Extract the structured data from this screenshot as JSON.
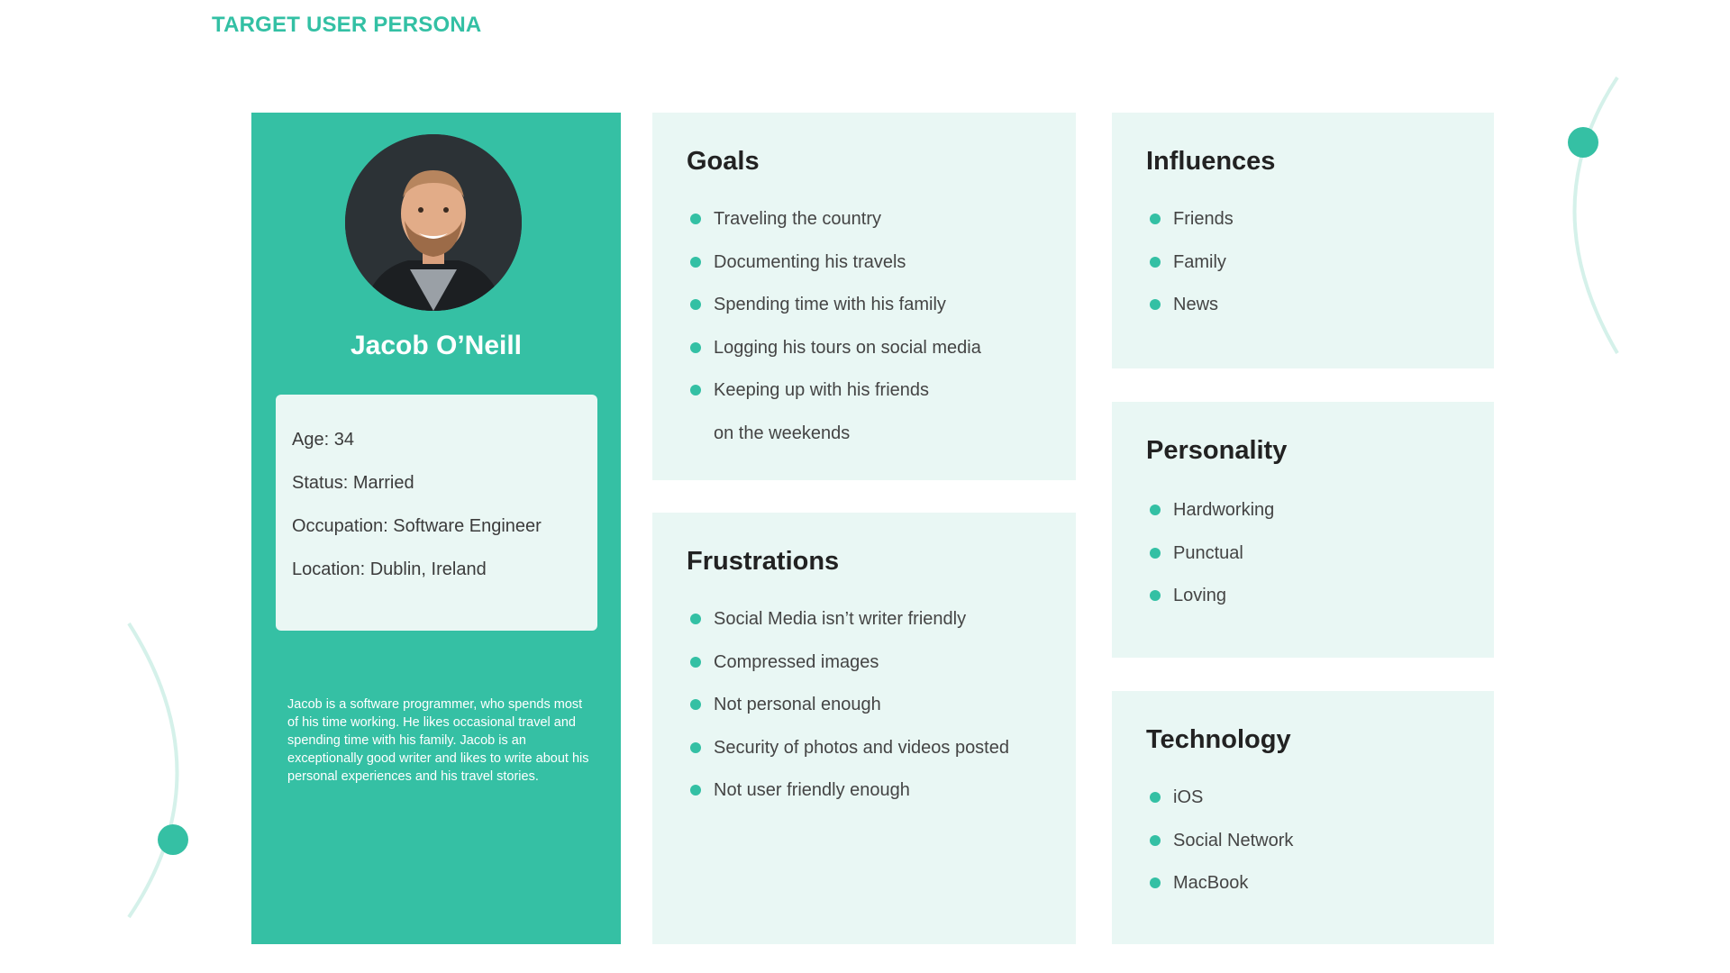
{
  "page": {
    "title": "TARGET USER PERSONA"
  },
  "colors": {
    "accent": "#35c0a4",
    "card_bg": "#e9f7f4",
    "info_bg": "#eaf7f4"
  },
  "profile": {
    "name": "Jacob O’Neill",
    "info": [
      "Age: 34",
      "Status: Married",
      "Occupation: Software Engineer",
      "Location: Dublin, Ireland"
    ],
    "bio": "Jacob is a software programmer, who spends most of his time working. He likes occasional travel and spending time with his family. Jacob is an exceptionally good writer and likes to write about his personal experiences and his travel stories."
  },
  "goals": {
    "heading": "Goals",
    "items": [
      "Traveling the country",
      "Documenting his travels",
      "Spending time with his family",
      "Logging his tours on social media",
      "Keeping up with his friends"
    ],
    "continuation": "on the weekends"
  },
  "frustrations": {
    "heading": "Frustrations",
    "items": [
      "Social Media isn’t writer friendly",
      "Compressed images",
      "Not personal enough",
      "Security of photos and videos posted",
      "Not user friendly enough"
    ]
  },
  "influences": {
    "heading": "Influences",
    "items": [
      "Friends",
      "Family",
      "News"
    ]
  },
  "personality": {
    "heading": "Personality",
    "items": [
      "Hardworking",
      "Punctual",
      "Loving"
    ]
  },
  "technology": {
    "heading": "Technology",
    "items": [
      "iOS",
      "Social Network",
      "MacBook"
    ]
  }
}
